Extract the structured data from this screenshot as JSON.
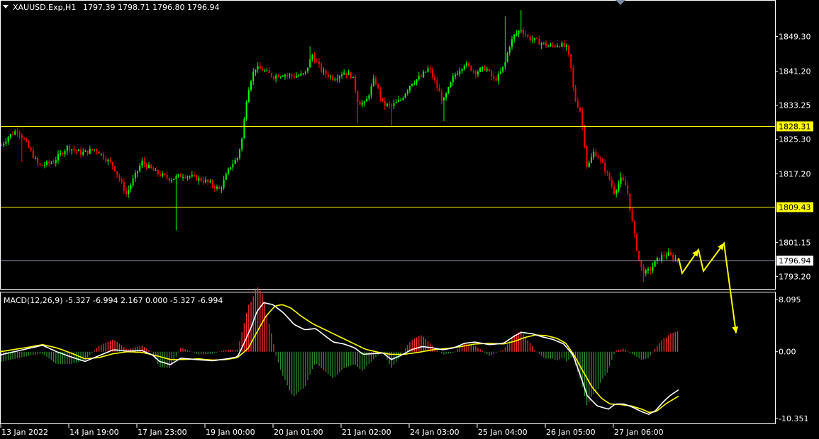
{
  "header": {
    "symbol": "XAUUSD.Exp,H1",
    "ohlc": "1797.39 1798.71 1796.80 1796.94",
    "macd_label": "MACD(12,26,9) -5.327 -6.994 2.167 0.000 -5.327 -6.994"
  },
  "colors": {
    "background": "#000000",
    "frame": "#ffffff",
    "bull_candle": "#00ff00",
    "bear_candle": "#ff0000",
    "level_line": "#ffff00",
    "price_line": "#a0a0c0",
    "macd_line": "#ffffff",
    "signal_line": "#ffff00",
    "hist_positive": "#ff3030",
    "hist_negative": "#2e8b2e",
    "arrow": "#ffff00"
  },
  "price_axis": {
    "ticks": [
      "1849.30",
      "1841.20",
      "1833.25",
      "1825.30",
      "1817.20",
      "1801.15",
      "1793.20"
    ],
    "levels": [
      "1828.31",
      "1809.43"
    ],
    "current": "1796.94"
  },
  "macd_axis": {
    "ticks": [
      "8.095",
      "0.00",
      "-10.351"
    ]
  },
  "time_axis": {
    "labels": [
      "13 Jan 2022",
      "14 Jan 19:00",
      "17 Jan 23:00",
      "19 Jan 00:00",
      "20 Jan 01:00",
      "21 Jan 02:00",
      "24 Jan 03:00",
      "25 Jan 04:00",
      "26 Jan 05:00",
      "27 Jan 06:00"
    ]
  },
  "chart_data": {
    "type": "candlestick",
    "symbol": "XAUUSD.Exp",
    "timeframe": "H1",
    "ylim": [
      1790.5,
      1857.5
    ],
    "y_ticks": [
      1849.3,
      1841.2,
      1833.25,
      1825.3,
      1817.2,
      1801.15,
      1793.2
    ],
    "x_labels": [
      "13 Jan 2022",
      "14 Jan 19:00",
      "17 Jan 23:00",
      "19 Jan 00:00",
      "20 Jan 01:00",
      "21 Jan 02:00",
      "24 Jan 03:00",
      "25 Jan 04:00",
      "26 Jan 05:00",
      "27 Jan 06:00"
    ],
    "horizontal_levels": [
      1828.31,
      1809.43
    ],
    "current_price": 1796.94,
    "last_bar": {
      "open": 1797.39,
      "high": 1798.71,
      "low": 1796.8,
      "close": 1796.94
    },
    "close_anchors": [
      [
        0,
        1823.5
      ],
      [
        12,
        1826.0
      ],
      [
        25,
        1827.5
      ],
      [
        38,
        1824.0
      ],
      [
        55,
        1819.0
      ],
      [
        75,
        1820.0
      ],
      [
        95,
        1823.5
      ],
      [
        115,
        1822.0
      ],
      [
        135,
        1823.0
      ],
      [
        160,
        1819.0
      ],
      [
        178,
        1812.5
      ],
      [
        200,
        1820.0
      ],
      [
        220,
        1817.5
      ],
      [
        240,
        1816.0
      ],
      [
        260,
        1817.0
      ],
      [
        290,
        1815.5
      ],
      [
        310,
        1813.5
      ],
      [
        325,
        1819.0
      ],
      [
        335,
        1821.0
      ],
      [
        342,
        1826.0
      ],
      [
        347,
        1834.0
      ],
      [
        352,
        1838.5
      ],
      [
        360,
        1842.0
      ],
      [
        370,
        1841.5
      ],
      [
        385,
        1840.0
      ],
      [
        400,
        1840.5
      ],
      [
        415,
        1840.0
      ],
      [
        430,
        1840.5
      ],
      [
        440,
        1845.0
      ],
      [
        455,
        1841.0
      ],
      [
        470,
        1839.5
      ],
      [
        485,
        1841.0
      ],
      [
        497,
        1840.0
      ],
      [
        505,
        1834.0
      ],
      [
        515,
        1833.5
      ],
      [
        528,
        1839.5
      ],
      [
        540,
        1833.5
      ],
      [
        552,
        1833.0
      ],
      [
        565,
        1834.5
      ],
      [
        580,
        1838.5
      ],
      [
        595,
        1840.0
      ],
      [
        605,
        1842.0
      ],
      [
        615,
        1838.0
      ],
      [
        625,
        1834.0
      ],
      [
        640,
        1840.0
      ],
      [
        655,
        1843.0
      ],
      [
        670,
        1841.0
      ],
      [
        685,
        1842.0
      ],
      [
        697,
        1839.0
      ],
      [
        705,
        1840.5
      ],
      [
        712,
        1843.0
      ],
      [
        718,
        1847.0
      ],
      [
        725,
        1849.5
      ],
      [
        735,
        1851.0
      ],
      [
        745,
        1849.0
      ],
      [
        760,
        1848.0
      ],
      [
        775,
        1847.0
      ],
      [
        790,
        1847.5
      ],
      [
        800,
        1846.5
      ],
      [
        805,
        1842.0
      ],
      [
        810,
        1835.0
      ],
      [
        818,
        1832.0
      ],
      [
        824,
        1825.0
      ],
      [
        828,
        1818.5
      ],
      [
        838,
        1822.5
      ],
      [
        848,
        1820.0
      ],
      [
        858,
        1816.5
      ],
      [
        866,
        1813.0
      ],
      [
        876,
        1816.0
      ],
      [
        884,
        1814.0
      ],
      [
        890,
        1807.5
      ],
      [
        896,
        1801.5
      ],
      [
        903,
        1795.5
      ],
      [
        910,
        1794.0
      ],
      [
        918,
        1795.0
      ],
      [
        926,
        1797.0
      ],
      [
        934,
        1798.0
      ],
      [
        942,
        1798.5
      ],
      [
        950,
        1797.5
      ],
      [
        957,
        1796.94
      ]
    ],
    "spikes": [
      {
        "x": 30,
        "low": 1820.0
      },
      {
        "x": 248,
        "low": 1804.0
      },
      {
        "x": 437,
        "high": 1847.0
      },
      {
        "x": 505,
        "low": 1829.0
      },
      {
        "x": 553,
        "low": 1828.5
      },
      {
        "x": 625,
        "low": 1829.5
      },
      {
        "x": 713,
        "high": 1854.0
      },
      {
        "x": 735,
        "high": 1855.5
      },
      {
        "x": 876,
        "high": 1817.5
      },
      {
        "x": 908,
        "low": 1792.0
      }
    ],
    "projection_path": [
      [
        957,
        1797.5
      ],
      [
        962,
        1794.0
      ],
      [
        985,
        1799.5
      ],
      [
        992,
        1794.5
      ],
      [
        1021,
        1801.0
      ],
      [
        1038,
        1780.0
      ]
    ],
    "macd": {
      "params": "12,26,9",
      "values": [
        -5.327,
        -6.994,
        2.167,
        0.0,
        -5.327,
        -6.994
      ],
      "ylim": [
        -10.351,
        8.095
      ],
      "macd_anchors": [
        [
          0,
          -0.5
        ],
        [
          40,
          0.5
        ],
        [
          60,
          1.0
        ],
        [
          80,
          0.0
        ],
        [
          100,
          -0.8
        ],
        [
          120,
          -1.5
        ],
        [
          140,
          -0.6
        ],
        [
          160,
          0.3
        ],
        [
          180,
          0.1
        ],
        [
          200,
          0.2
        ],
        [
          215,
          -0.5
        ],
        [
          225,
          -1.5
        ],
        [
          240,
          -2.0
        ],
        [
          255,
          -1.0
        ],
        [
          275,
          -1.2
        ],
        [
          300,
          -1.4
        ],
        [
          320,
          -1.1
        ],
        [
          335,
          -0.8
        ],
        [
          345,
          1.5
        ],
        [
          355,
          4.0
        ],
        [
          362,
          6.2
        ],
        [
          372,
          7.6
        ],
        [
          385,
          7.3
        ],
        [
          400,
          6.0
        ],
        [
          415,
          4.2
        ],
        [
          430,
          3.4
        ],
        [
          445,
          3.6
        ],
        [
          458,
          2.5
        ],
        [
          470,
          1.5
        ],
        [
          485,
          1.2
        ],
        [
          500,
          0.6
        ],
        [
          512,
          -0.4
        ],
        [
          525,
          -0.3
        ],
        [
          540,
          -0.2
        ],
        [
          552,
          -1.2
        ],
        [
          565,
          -0.6
        ],
        [
          580,
          0.3
        ],
        [
          595,
          0.8
        ],
        [
          610,
          0.6
        ],
        [
          625,
          0.3
        ],
        [
          640,
          0.6
        ],
        [
          655,
          1.3
        ],
        [
          670,
          1.5
        ],
        [
          690,
          1.1
        ],
        [
          710,
          1.3
        ],
        [
          725,
          2.4
        ],
        [
          735,
          3.0
        ],
        [
          750,
          2.8
        ],
        [
          765,
          2.3
        ],
        [
          780,
          1.9
        ],
        [
          795,
          1.2
        ],
        [
          808,
          -0.5
        ],
        [
          818,
          -3.5
        ],
        [
          828,
          -6.8
        ],
        [
          842,
          -8.4
        ],
        [
          858,
          -8.9
        ],
        [
          868,
          -8.1
        ],
        [
          880,
          -8.1
        ],
        [
          892,
          -8.6
        ],
        [
          905,
          -9.3
        ],
        [
          915,
          -9.7
        ],
        [
          925,
          -9.1
        ],
        [
          935,
          -7.8
        ],
        [
          945,
          -6.8
        ],
        [
          957,
          -5.9
        ]
      ],
      "signal_anchors": [
        [
          0,
          0.0
        ],
        [
          40,
          0.7
        ],
        [
          60,
          1.1
        ],
        [
          80,
          0.6
        ],
        [
          100,
          -0.2
        ],
        [
          120,
          -1.1
        ],
        [
          140,
          -0.9
        ],
        [
          160,
          -0.3
        ],
        [
          180,
          0.0
        ],
        [
          200,
          -0.1
        ],
        [
          220,
          -0.6
        ],
        [
          240,
          -1.2
        ],
        [
          260,
          -1.2
        ],
        [
          280,
          -1.1
        ],
        [
          300,
          -1.3
        ],
        [
          320,
          -1.2
        ],
        [
          335,
          -0.9
        ],
        [
          350,
          0.5
        ],
        [
          362,
          3.0
        ],
        [
          375,
          5.5
        ],
        [
          388,
          7.1
        ],
        [
          398,
          7.3
        ],
        [
          410,
          6.8
        ],
        [
          425,
          5.5
        ],
        [
          440,
          4.4
        ],
        [
          455,
          3.6
        ],
        [
          470,
          2.8
        ],
        [
          485,
          2.0
        ],
        [
          500,
          1.2
        ],
        [
          515,
          0.4
        ],
        [
          530,
          0.0
        ],
        [
          550,
          -0.4
        ],
        [
          570,
          -0.4
        ],
        [
          590,
          -0.1
        ],
        [
          610,
          0.3
        ],
        [
          630,
          0.5
        ],
        [
          650,
          0.8
        ],
        [
          670,
          1.2
        ],
        [
          690,
          1.3
        ],
        [
          710,
          1.2
        ],
        [
          725,
          1.6
        ],
        [
          740,
          2.2
        ],
        [
          755,
          2.6
        ],
        [
          770,
          2.5
        ],
        [
          785,
          2.1
        ],
        [
          798,
          1.3
        ],
        [
          810,
          -0.6
        ],
        [
          822,
          -3.0
        ],
        [
          835,
          -5.5
        ],
        [
          848,
          -7.2
        ],
        [
          860,
          -8.1
        ],
        [
          875,
          -8.2
        ],
        [
          890,
          -8.4
        ],
        [
          905,
          -8.9
        ],
        [
          915,
          -9.4
        ],
        [
          925,
          -9.3
        ],
        [
          940,
          -8.0
        ],
        [
          957,
          -6.9
        ]
      ]
    }
  }
}
